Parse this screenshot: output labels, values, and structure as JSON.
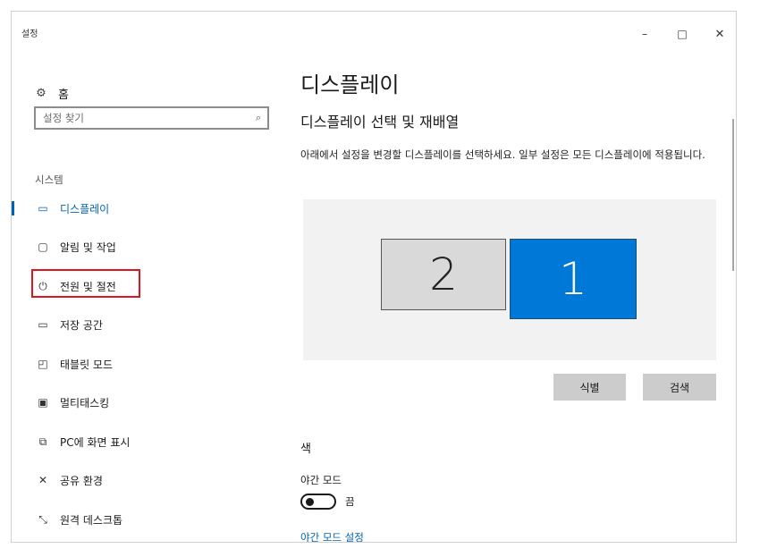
{
  "window": {
    "title": "설정",
    "controls": {
      "minimize": "–",
      "maximize": "□",
      "close": "✕"
    }
  },
  "sidebar": {
    "home_label": "홈",
    "search_placeholder": "설정 찾기",
    "section_label": "시스템",
    "items": [
      {
        "label": "디스플레이",
        "icon": "monitor-icon",
        "active": true
      },
      {
        "label": "알림 및 작업",
        "icon": "notification-icon",
        "active": false
      },
      {
        "label": "전원 및 절전",
        "icon": "power-icon",
        "active": false,
        "highlighted": true
      },
      {
        "label": "저장 공간",
        "icon": "storage-icon",
        "active": false
      },
      {
        "label": "태블릿 모드",
        "icon": "tablet-icon",
        "active": false
      },
      {
        "label": "멀티태스킹",
        "icon": "multitasking-icon",
        "active": false
      },
      {
        "label": "PC에 화면 표시",
        "icon": "project-icon",
        "active": false
      },
      {
        "label": "공유 환경",
        "icon": "shared-experiences-icon",
        "active": false
      },
      {
        "label": "원격 데스크톱",
        "icon": "remote-desktop-icon",
        "active": false
      }
    ]
  },
  "main": {
    "title": "디스플레이",
    "subheading": "디스플레이 선택 및 재배열",
    "description": "아래에서 설정을 변경할 디스플레이를 선택하세요. 일부 설정은 모든 디스플레이에 적용됩니다.",
    "monitors": [
      {
        "number": "2",
        "selected": false
      },
      {
        "number": "1",
        "selected": true
      }
    ],
    "identify_button": "식별",
    "detect_button": "검색",
    "color_heading": "색",
    "night_light_label": "야간 모드",
    "night_light_state": "끔",
    "night_light_settings_link": "야간 모드 설정"
  },
  "colors": {
    "accent": "#0078d7",
    "link": "#0063b1",
    "highlight_box": "#e0141e",
    "button_bg": "#cccccc",
    "display_area_bg": "#f2f2f2"
  }
}
